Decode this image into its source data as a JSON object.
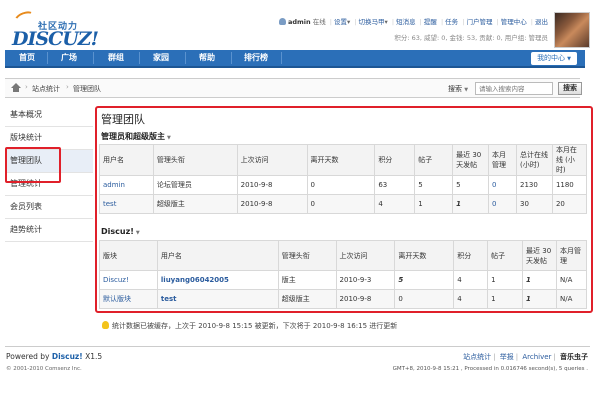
{
  "logo": {
    "cn": "社区动力",
    "en": "DISCUZ!"
  },
  "userbar": {
    "username": "admin",
    "status": "在线",
    "items": [
      "设置",
      "切换马甲",
      "短消息",
      "提醒",
      "任务",
      "门户管理",
      "管理中心",
      "退出"
    ]
  },
  "credits": "积分: 63, 威望: 0, 金钱: 53, 贡献: 0, 用户组: 管理员",
  "nav": {
    "items": [
      "首页",
      "广场",
      "群组",
      "家园",
      "帮助",
      "排行榜"
    ],
    "mycenter": "我的中心"
  },
  "breadcrumb": [
    "站点统计",
    "管理团队"
  ],
  "search": {
    "label": "搜索",
    "placeholder": "请输入搜索内容",
    "button": "搜索"
  },
  "sidebar": {
    "items": [
      "基本概况",
      "版块统计",
      "管理团队",
      "管理统计",
      "会员列表",
      "趋势统计"
    ]
  },
  "main": {
    "title": "管理团队",
    "section1": {
      "title": "管理员和超级版主",
      "headers": [
        "用户名",
        "管理头衔",
        "上次访问",
        "离开天数",
        "积分",
        "帖子",
        "最近 30 天发帖",
        "本月管理",
        "总计在线 (小时)",
        "本月在线 (小时)"
      ],
      "rows": [
        [
          "admin",
          "论坛管理员",
          "2010-9-8",
          "0",
          "63",
          "5",
          "5",
          "0",
          "2130",
          "1180"
        ],
        [
          "test",
          "超级版主",
          "2010-9-8",
          "0",
          "4",
          "1",
          "1",
          "0",
          "30",
          "20"
        ]
      ]
    },
    "section2": {
      "title": "Discuz!",
      "headers": [
        "版块",
        "用户名",
        "管理头衔",
        "上次访问",
        "离开天数",
        "积分",
        "帖子",
        "最近 30 天发帖",
        "本月管理"
      ],
      "rows": [
        [
          "Discuz!",
          "liuyang06042005",
          "版主",
          "2010-9-3",
          "5",
          "4",
          "1",
          "1",
          "N/A"
        ],
        [
          "默认版块",
          "test",
          "超级版主",
          "2010-9-8",
          "0",
          "4",
          "1",
          "1",
          "N/A"
        ]
      ]
    }
  },
  "notice": "统计数据已被缓存，上次于 2010-9-8 15:15 被更新，下次将于 2010-9-8 16:15 进行更新",
  "footer": {
    "powered_prefix": "Powered by ",
    "powered_brand": "Discuz!",
    "powered_version": " X1.5",
    "copyright": "© 2001-2010 Comsenz Inc.",
    "links": [
      "站点统计",
      "举报",
      "Archiver",
      "音乐虫子"
    ],
    "gmt": "GMT+8, 2010-9-8 15:21 , Processed in 0.016746 second(s), 5 queries ."
  }
}
